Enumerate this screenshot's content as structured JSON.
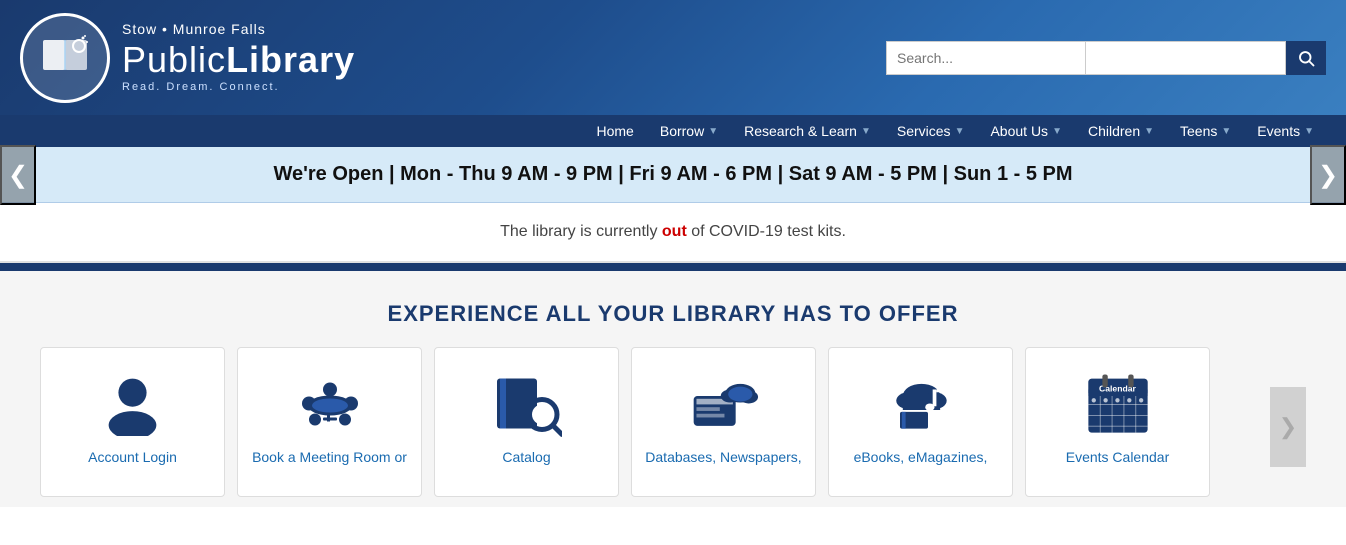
{
  "header": {
    "library_name_top": "Stow • Munroe Falls",
    "library_name_public": "Public",
    "library_name_library": "Library",
    "tagline": "Read. Dream. Connect.",
    "search_placeholder": "Search...",
    "search_placeholder2": ""
  },
  "nav": {
    "items": [
      {
        "label": "Home",
        "has_dropdown": false
      },
      {
        "label": "Borrow",
        "has_dropdown": true
      },
      {
        "label": "Research & Learn",
        "has_dropdown": true
      },
      {
        "label": "Services",
        "has_dropdown": true
      },
      {
        "label": "About Us",
        "has_dropdown": true
      },
      {
        "label": "Children",
        "has_dropdown": true
      },
      {
        "label": "Teens",
        "has_dropdown": true
      },
      {
        "label": "Events",
        "has_dropdown": true
      }
    ]
  },
  "hours": {
    "text": "We're Open | Mon - Thu 9 AM - 9 PM | Fri 9 AM - 6 PM | Sat 9 AM - 5 PM | Sun 1 - 5 PM"
  },
  "covid": {
    "prefix": "The library is currently ",
    "out_word": "out",
    "suffix": " of COVID-19 test kits."
  },
  "experience": {
    "title": "EXPERIENCE ALL YOUR LIBRARY HAS TO OFFER"
  },
  "cards": [
    {
      "label": "Account Login",
      "icon": "person"
    },
    {
      "label": "Book a Meeting Room or",
      "icon": "meeting"
    },
    {
      "label": "Catalog",
      "icon": "catalog"
    },
    {
      "label": "Databases, Newspapers,",
      "icon": "databases"
    },
    {
      "label": "eBooks, eMagazines,",
      "icon": "ebooks"
    },
    {
      "label": "Events Calendar",
      "icon": "calendar"
    }
  ],
  "icons": {
    "search": "🔍",
    "chevron_right": "❯",
    "chevron_left": "❮"
  }
}
